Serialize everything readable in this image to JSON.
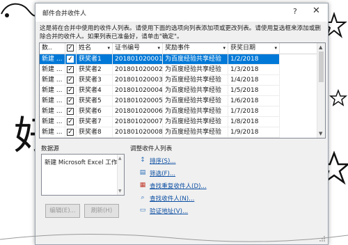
{
  "dialog": {
    "title": "邮件合并收件人",
    "help_glyph": "?",
    "close_glyph": "✕",
    "instructions": "这是将在合并中使用的收件人列表。请使用下面的选项向列表添加项或更改列表。请使用复选框来添加或删除合并的收件人。如果列表已准备好，请单击\"确定\"。"
  },
  "table": {
    "columns": [
      {
        "label": "数..",
        "arrow": "▾"
      },
      {
        "label": "✓",
        "arrow": ""
      },
      {
        "label": "姓名",
        "arrow": "▾"
      },
      {
        "label": "证书编号",
        "arrow": "▾"
      },
      {
        "label": "奖励事件",
        "arrow": "▾"
      },
      {
        "label": "获奖日期",
        "arrow": "▾"
      }
    ],
    "rows": [
      {
        "source": "新建 ...",
        "checked": "✓",
        "name": "获奖者1",
        "cert": "201801020001",
        "event": "为百度经验共享经验",
        "date": "1/2/2018"
      },
      {
        "source": "新建 ...",
        "checked": "✓",
        "name": "获奖者2",
        "cert": "201801020002",
        "event": "为百度经验共享经验",
        "date": "1/3/2018"
      },
      {
        "source": "新建 ...",
        "checked": "✓",
        "name": "获奖者3",
        "cert": "201801020003",
        "event": "为百度经验共享经验",
        "date": "1/4/2018"
      },
      {
        "source": "新建 ...",
        "checked": "✓",
        "name": "获奖者4",
        "cert": "201801020004",
        "event": "为百度经验共享经验",
        "date": "1/5/2018"
      },
      {
        "source": "新建 ...",
        "checked": "✓",
        "name": "获奖者5",
        "cert": "201801020005",
        "event": "为百度经验共享经验",
        "date": "1/6/2018"
      },
      {
        "source": "新建 ...",
        "checked": "✓",
        "name": "获奖者6",
        "cert": "201801020006",
        "event": "为百度经验共享经验",
        "date": "1/7/2018"
      },
      {
        "source": "新建 ...",
        "checked": "✓",
        "name": "获奖者7",
        "cert": "201801020007",
        "event": "为百度经验共享经验",
        "date": "1/8/2018"
      },
      {
        "source": "新建 ...",
        "checked": "✓",
        "name": "获奖者8",
        "cert": "201801020008",
        "event": "为百度经验共享经验",
        "date": "1/9/2018"
      }
    ],
    "selected_row": 0
  },
  "data_source": {
    "label": "数据源",
    "item": "新建 Microsoft Excel 工作表",
    "edit_button": "编辑(E)...",
    "refresh_button": "刷新(H)"
  },
  "refine": {
    "label": "调整收件人列表",
    "links": [
      {
        "label": "排序(S)...",
        "icon": "sort-icon",
        "glyph": "↕"
      },
      {
        "label": "筛选(F)...",
        "icon": "filter-icon",
        "glyph": "▤"
      },
      {
        "label": "查找重复收件人(D)...",
        "icon": "find-duplicates-icon",
        "glyph": "▦"
      },
      {
        "label": "查找收件人(N)...",
        "icon": "find-recipient-icon",
        "glyph": "⌕"
      },
      {
        "label": "验证地址(V)...",
        "icon": "validate-address-icon",
        "glyph": "▭"
      }
    ]
  },
  "colors": {
    "selection": "#0078d7",
    "link": "#0b4ea2"
  }
}
